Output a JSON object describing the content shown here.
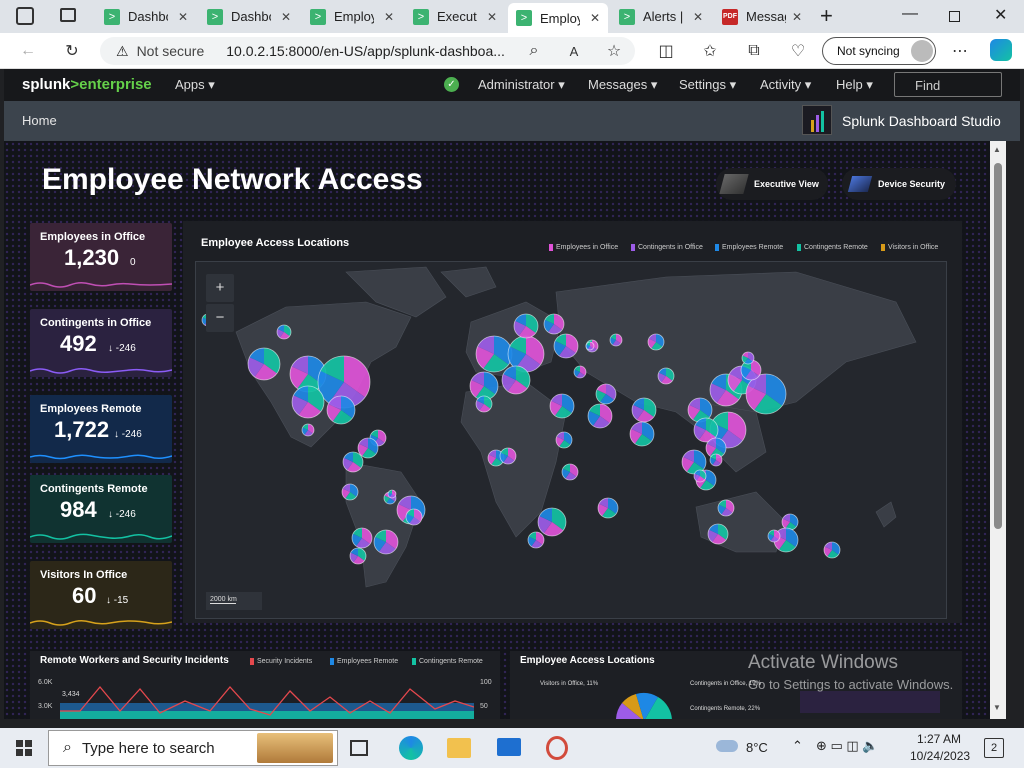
{
  "browser": {
    "tabs": [
      {
        "label": "Dashbo",
        "icon": "splunk-icon"
      },
      {
        "label": "Dashbo",
        "icon": "splunk-icon"
      },
      {
        "label": "Employ",
        "icon": "splunk-icon"
      },
      {
        "label": "Executi",
        "icon": "splunk-icon"
      },
      {
        "label": "Employ",
        "icon": "splunk-icon",
        "active": true
      },
      {
        "label": "Alerts |",
        "icon": "splunk-icon"
      },
      {
        "label": "Messag",
        "icon": "pdf-icon"
      }
    ],
    "security": "Not secure",
    "url": "10.0.2.15:8000/en-US/app/splunk-dashboa...",
    "sync": "Not syncing"
  },
  "splunk": {
    "logo_a": "splunk",
    "logo_b": ">enterprise",
    "nav": {
      "apps": "Apps ▾",
      "admin": "Administrator ▾",
      "messages": "Messages ▾",
      "settings": "Settings ▾",
      "activity": "Activity ▾",
      "help": "Help ▾",
      "find": "Find"
    },
    "home": "Home",
    "studio": "Splunk Dashboard Studio"
  },
  "dashboard": {
    "title": "Employee Network Access",
    "buttons": {
      "executive": "Executive View",
      "device": "Device Security"
    },
    "kpis": [
      {
        "title": "Employees in Office",
        "value": "1,230",
        "delta": "0",
        "color": "#3a2437",
        "line": "#c04fb4"
      },
      {
        "title": "Contingents in Office",
        "value": "492",
        "delta": "↓ -246",
        "color": "#2b2240",
        "line": "#8b5cf6"
      },
      {
        "title": "Employees Remote",
        "value": "1,722",
        "delta": "↓ -246",
        "color": "#12294a",
        "line": "#1e90ff"
      },
      {
        "title": "Contingents Remote",
        "value": "984",
        "delta": "↓ -246",
        "color": "#103331",
        "line": "#13c2a3"
      },
      {
        "title": "Visitors In Office",
        "value": "60",
        "delta": "↓ -15",
        "color": "#2c2718",
        "line": "#d7a21c"
      }
    ],
    "map": {
      "title": "Employee Access Locations",
      "legend": [
        {
          "label": "Employees in Office",
          "color": "#e052d8"
        },
        {
          "label": "Contingents in Office",
          "color": "#9d5ce8"
        },
        {
          "label": "Employees Remote",
          "color": "#1e88e5"
        },
        {
          "label": "Contingents Remote",
          "color": "#13c2a3"
        },
        {
          "label": "Visitors in Office",
          "color": "#d79a18"
        }
      ],
      "zoom_in": "+",
      "zoom_out": "−",
      "scale": "2000 km"
    },
    "incidents": {
      "title": "Remote Workers and Security Incidents",
      "legend": [
        {
          "label": "Security Incidents",
          "color": "#e5484d"
        },
        {
          "label": "Employees Remote",
          "color": "#1e88e5"
        },
        {
          "label": "Contingents Remote",
          "color": "#13c2a3"
        }
      ],
      "y_left": [
        "6.0K",
        "3.0K"
      ],
      "y_right": [
        "100",
        "50"
      ],
      "marker": "3,434"
    },
    "access_pie": {
      "title": "Employee Access Locations",
      "label_a": "Visitors in Office, 11%",
      "label_b": "Contingents in Office, 19%",
      "label_c": "Contingents Remote, 22%"
    }
  },
  "watermark": {
    "line1": "Activate Windows",
    "line2": "Go to Settings to activate Windows."
  },
  "taskbar": {
    "search": "Type here to search",
    "temp": "8°C",
    "time": "1:27 AM",
    "date": "10/24/2023",
    "notif": "2"
  }
}
